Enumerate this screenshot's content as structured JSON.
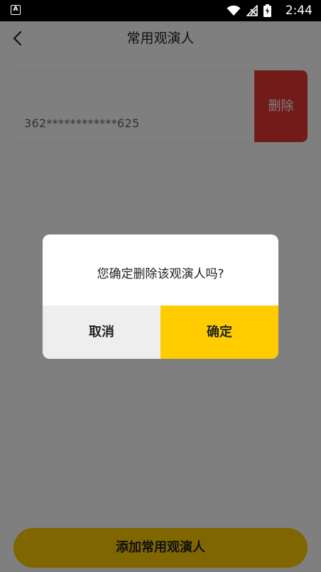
{
  "status_bar": {
    "time": "2:44",
    "app_icon_letter": "A",
    "icons": [
      "wifi-icon",
      "signal-off-icon",
      "battery-charging-icon"
    ]
  },
  "header": {
    "title": "常用观演人",
    "back_icon": "chevron-left-icon"
  },
  "viewers": [
    {
      "id_masked": "362************625",
      "delete_label": "删除"
    }
  ],
  "add_button_label": "添加常用观演人",
  "dialog": {
    "message": "您确定删除该观演人吗?",
    "cancel_label": "取消",
    "confirm_label": "确定"
  },
  "colors": {
    "accent": "#ffcc00",
    "danger": "#e53935",
    "overlay": "rgba(0,0,0,0.5)"
  }
}
